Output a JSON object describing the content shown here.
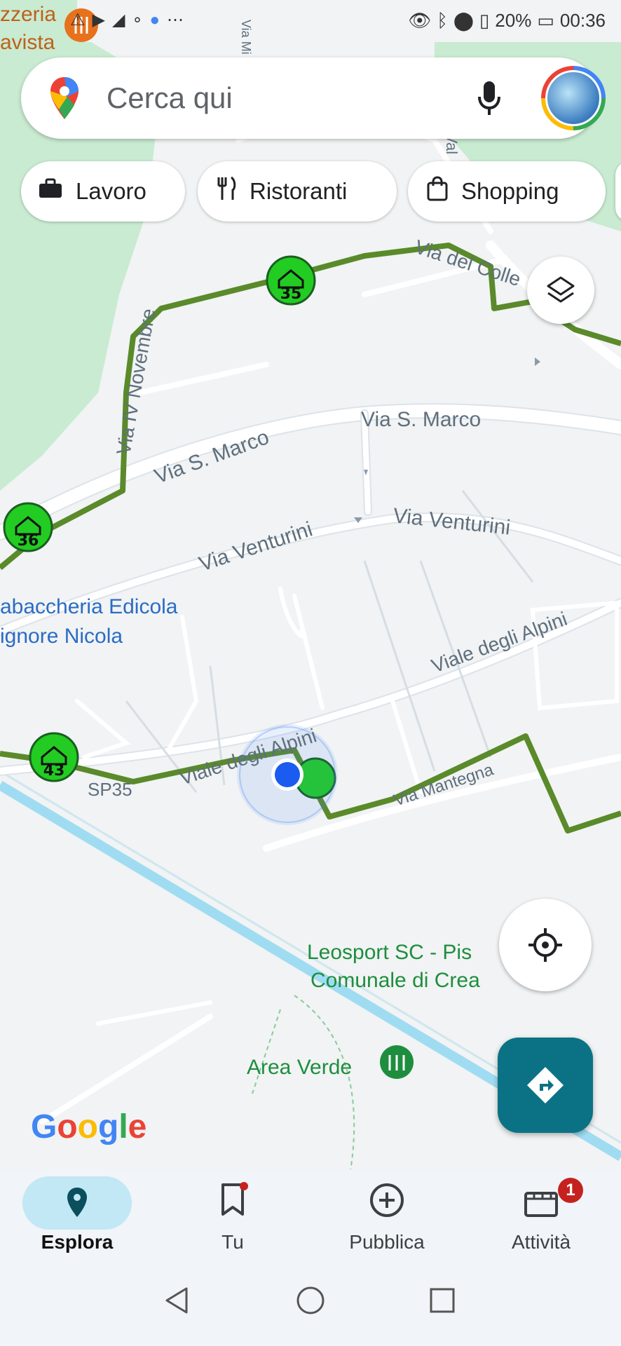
{
  "status_bar": {
    "battery": "20%",
    "time": "00:36",
    "left_icons": [
      "restaurant-icon",
      "warning-icon",
      "youtube-icon",
      "signal-icon",
      "dot-icon",
      "chrome-icon",
      "more-icon"
    ],
    "right_icons": [
      "eye-icon",
      "bluetooth-icon",
      "location-icon",
      "vibrate-icon",
      "battery-icon"
    ]
  },
  "search": {
    "placeholder": "Cerca qui"
  },
  "chips": [
    {
      "label": "Lavoro",
      "icon": "briefcase-icon"
    },
    {
      "label": "Ristoranti",
      "icon": "restaurant-icon"
    },
    {
      "label": "Shopping",
      "icon": "shopping-bag-icon"
    }
  ],
  "map": {
    "streets": {
      "via_del_colle": "Via del Colle",
      "via_iv_novembre": "Via IV Novembre",
      "via_s_marco_1": "Via S. Marco",
      "via_s_marco_2": "Via S. Marco",
      "via_venturini_1": "Via Venturini",
      "via_venturini_2": "Via Venturini",
      "viale_degli_alpini_1": "Viale degli Alpini",
      "viale_degli_alpini_2": "Viale degli Alpini",
      "via_mantegna": "Via Mantegna",
      "sp35": "SP35",
      "via_mi": "Via Mi",
      "via_val": "Val"
    },
    "places": {
      "pizzeria_1": "zzeria",
      "pizzeria_2": "avista",
      "tabaccheria_1": "abaccheria Edicola",
      "tabaccheria_2": "ignore Nicola",
      "leosport_1": "Leosport SC - Pis",
      "leosport_2": "Comunale di Crea",
      "area_verde": "Area Verde"
    },
    "markers": [
      "35",
      "36",
      "43"
    ],
    "route_color": "#5a8a2a",
    "marker_color": "#22cc22",
    "water_color": "#9fdcf2",
    "park_color": "#c8ebd1"
  },
  "google_logo": "Google",
  "bottom_nav": {
    "items": [
      {
        "label": "Esplora",
        "icon": "explore-pin-icon",
        "active": true
      },
      {
        "label": "Tu",
        "icon": "bookmark-icon",
        "dot": true
      },
      {
        "label": "Pubblica",
        "icon": "add-circle-icon"
      },
      {
        "label": "Attività",
        "icon": "business-icon",
        "badge": "1"
      }
    ]
  },
  "system_nav": [
    "back-icon",
    "home-icon",
    "recents-icon"
  ]
}
